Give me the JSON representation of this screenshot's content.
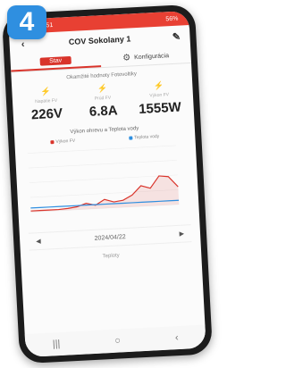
{
  "badge": "4",
  "status_bar": {
    "left": "5:51",
    "right": "56%"
  },
  "app": {
    "title": "COV Sokolany 1",
    "back_icon": "back-arrow-icon",
    "edit_icon": "pencil-icon"
  },
  "tabs": [
    {
      "label": "Stav",
      "active": true
    },
    {
      "label": "Konfigurácia",
      "active": false
    }
  ],
  "values": {
    "title": "Okamžité hodnoty Fotovoltiky",
    "cards": [
      {
        "label": "Napätie FV",
        "value": "226V"
      },
      {
        "label": "Prúd FV",
        "value": "6.8A"
      },
      {
        "label": "Výkon FV",
        "value": "1555W"
      }
    ]
  },
  "chart": {
    "title": "Výkon ohrevu a Teplota vody",
    "legend": [
      {
        "name": "Výkon FV",
        "color": "#d9342b"
      },
      {
        "name": "Teplota vody",
        "color": "#2f8fe0"
      }
    ]
  },
  "chart_data": {
    "type": "area",
    "series": [
      {
        "name": "Výkon FV",
        "values": [
          0.02,
          0.02,
          0.02,
          0.02,
          0.03,
          0.05,
          0.1,
          0.06,
          0.15,
          0.1,
          0.12,
          0.2,
          0.35,
          0.3,
          0.5,
          0.48,
          0.3
        ]
      },
      {
        "name": "Teplota vody",
        "values": [
          0.07,
          0.07,
          0.07,
          0.07,
          0.07,
          0.07,
          0.07,
          0.07,
          0.07,
          0.07,
          0.07,
          0.07,
          0.07,
          0.07,
          0.07,
          0.07,
          0.07
        ]
      }
    ],
    "ylim": [
      0,
      1
    ]
  },
  "date_nav": {
    "date": "2024/04/22",
    "prev": "◀",
    "next": "▶"
  },
  "sublabel": "Teploty",
  "navbar": [
    "|||",
    "○",
    "‹"
  ]
}
